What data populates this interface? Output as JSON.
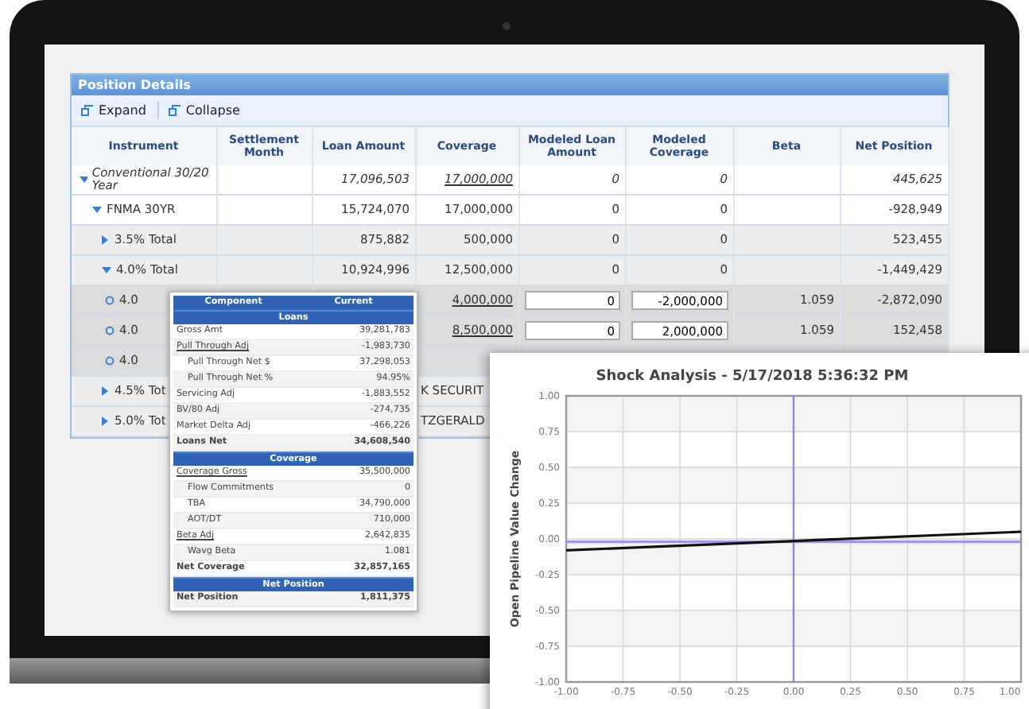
{
  "panel": {
    "title": "Position Details",
    "toolbar": [
      {
        "label": "Expand"
      },
      {
        "label": "Collapse"
      }
    ],
    "columns": [
      "Instrument",
      "Settlement Month",
      "Loan Amount",
      "Coverage",
      "Modeled Loan Amount",
      "Modeled Coverage",
      "Beta",
      "Net Position"
    ],
    "rows": [
      {
        "kind": "group",
        "label": "Conventional 30/20 Year",
        "expanded": true,
        "loan": "17,096,503",
        "coverage": "17,000,000",
        "modeled_loan": "0",
        "modeled_coverage": "0",
        "net": "445,625",
        "children": [
          {
            "kind": "subgroup",
            "label": "FNMA 30YR",
            "expanded": true,
            "loan": "15,724,070",
            "coverage": "17,000,000",
            "modeled_loan": "0",
            "modeled_coverage": "0",
            "net": "-928,949",
            "children": [
              {
                "kind": "total",
                "label": "3.5% Total",
                "expanded": false,
                "loan": "875,882",
                "coverage": "500,000",
                "modeled_loan": "0",
                "modeled_coverage": "0",
                "net": "523,455"
              },
              {
                "kind": "total",
                "label": "4.0% Total",
                "expanded": true,
                "loan": "10,924,996",
                "coverage": "12,500,000",
                "modeled_loan": "0",
                "modeled_coverage": "0",
                "net": "-1,449,429",
                "children": [
                  {
                    "kind": "position",
                    "label": "4.0",
                    "coverage": "4,000,000",
                    "modeled_loan": "0",
                    "modeled_coverage": "-2,000,000",
                    "beta": "1.059",
                    "net": "-2,872,090"
                  },
                  {
                    "kind": "position",
                    "label": "4.0",
                    "coverage": "8,500,000",
                    "modeled_loan": "0",
                    "modeled_coverage": "2,000,000",
                    "beta": "1.059",
                    "net": "152,458"
                  },
                  {
                    "kind": "position",
                    "label": "4.0"
                  }
                ]
              },
              {
                "kind": "total",
                "label": "4.5% Tot",
                "expanded": false,
                "coverage": "K SECURIT"
              },
              {
                "kind": "total",
                "label": "5.0% Tot",
                "expanded": false,
                "coverage": "TZGERALD"
              }
            ]
          }
        ]
      }
    ]
  },
  "tooltip": {
    "columns": [
      "Component",
      "Current"
    ],
    "sections": [
      {
        "title": "Loans",
        "rows": [
          {
            "kind": "item",
            "label": "Gross Amt",
            "value": "39,281,783"
          },
          {
            "kind": "link",
            "label": "Pull Through Adj",
            "value": "-1,983,730"
          },
          {
            "kind": "sub",
            "label": "Pull Through Net $",
            "value": "37,298,053"
          },
          {
            "kind": "sub",
            "label": "Pull Through Net %",
            "value": "94.95%"
          },
          {
            "kind": "item",
            "label": "Servicing Adj",
            "value": "-1,883,552"
          },
          {
            "kind": "item",
            "label": "BV/80 Adj",
            "value": "-274,735"
          },
          {
            "kind": "item",
            "label": "Market Delta Adj",
            "value": "-466,226"
          },
          {
            "kind": "total",
            "label": "Loans Net",
            "value": "34,608,540"
          }
        ]
      },
      {
        "title": "Coverage",
        "rows": [
          {
            "kind": "link",
            "label": "Coverage Gross",
            "value": "35,500,000"
          },
          {
            "kind": "sub",
            "label": "Flow Commitments",
            "value": "0"
          },
          {
            "kind": "sub",
            "label": "TBA",
            "value": "34,790,000"
          },
          {
            "kind": "sub",
            "label": "AOT/DT",
            "value": "710,000"
          },
          {
            "kind": "link",
            "label": "Beta Adj",
            "value": "2,642,835"
          },
          {
            "kind": "sub",
            "label": "Wavg Beta",
            "value": "1.081"
          },
          {
            "kind": "total",
            "label": "Net Coverage",
            "value": "32,857,165"
          }
        ]
      },
      {
        "title": "Net Position",
        "rows": [
          {
            "kind": "total",
            "label": "Net Position",
            "value": "1,811,375"
          }
        ]
      }
    ]
  },
  "chart": {
    "chart_data": {
      "type": "line",
      "title": "Shock Analysis - 5/17/2018 5:36:32 PM",
      "ylabel": "Open Pipeline Value Change",
      "x": [
        -1,
        1
      ],
      "series": [
        {
          "color": "#111111",
          "values": [
            -0.08,
            0.05
          ]
        },
        {
          "color": "#9f98e0",
          "values": [
            -0.02,
            -0.02
          ]
        }
      ],
      "xlim": [
        -1,
        1
      ],
      "ylim": [
        -1,
        1
      ],
      "grid": true,
      "xticks": [
        {
          "value": -1,
          "label": "-1.00"
        },
        {
          "value": -0.75,
          "label": "-0.75"
        },
        {
          "value": -0.5,
          "label": "-0.50"
        },
        {
          "value": -0.25,
          "label": "-0.25"
        },
        {
          "value": 0,
          "label": "0.00"
        },
        {
          "value": 0.25,
          "label": "0.25"
        },
        {
          "value": 0.5,
          "label": "0.50"
        },
        {
          "value": 0.75,
          "label": "0.75"
        },
        {
          "value": 1,
          "label": "1.00"
        }
      ],
      "yticks": [
        {
          "value": -1,
          "label": "-1.00"
        },
        {
          "value": -0.75,
          "label": "-0.75"
        },
        {
          "value": -0.5,
          "label": "-0.50"
        },
        {
          "value": -0.25,
          "label": "-0.25"
        },
        {
          "value": 0,
          "label": "0.00"
        },
        {
          "value": 0.25,
          "label": "0.25"
        },
        {
          "value": 0.5,
          "label": "0.50"
        },
        {
          "value": 0.75,
          "label": "0.75"
        },
        {
          "value": 1,
          "label": "1.00"
        }
      ],
      "ref_lines": [
        {
          "axis": "x",
          "value": 0,
          "color": "#8e86d8"
        }
      ]
    }
  }
}
